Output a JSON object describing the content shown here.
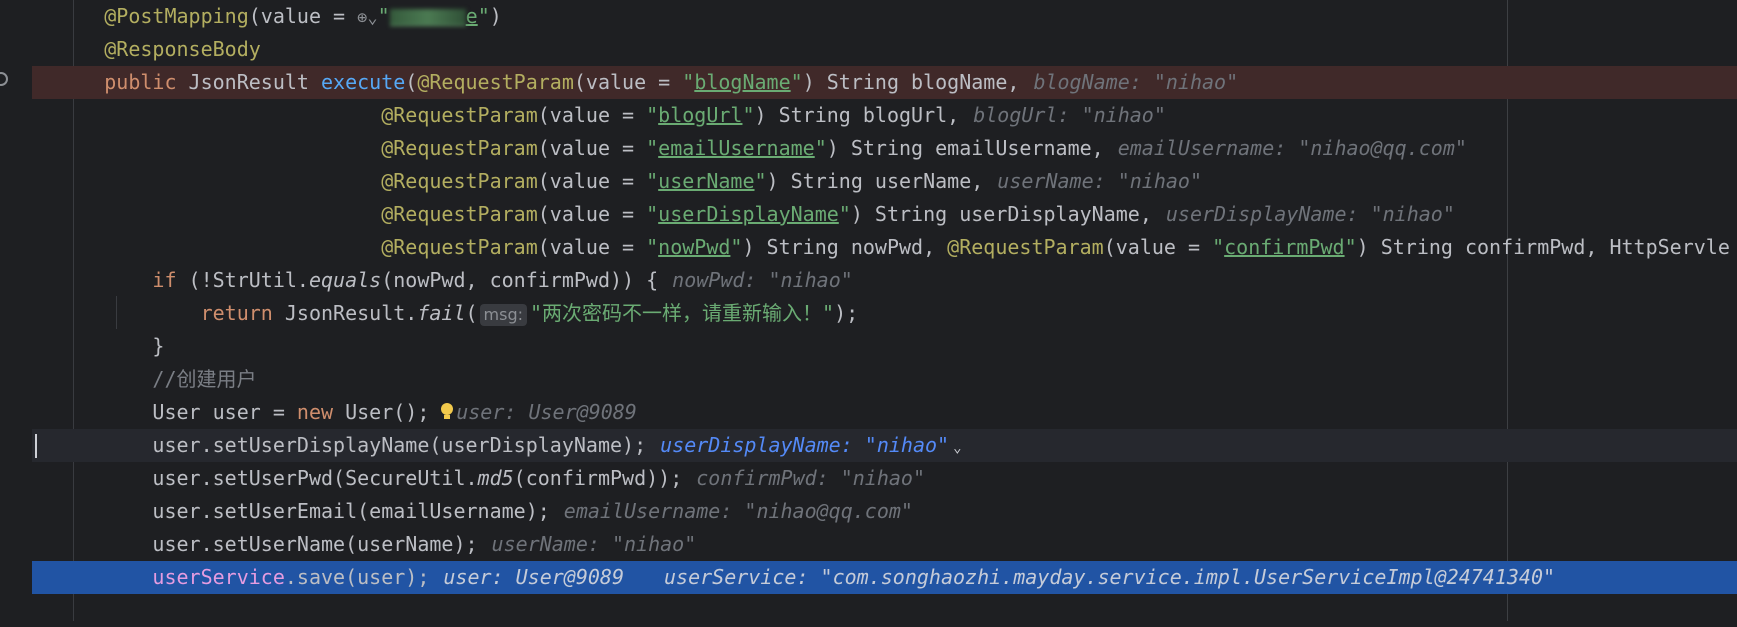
{
  "lines": [
    {
      "indent": "    ",
      "segments": [
        {
          "t": "@PostMapping",
          "c": "ann"
        },
        {
          "t": "(value = "
        },
        {
          "icon": "globe"
        },
        {
          "t": "\"",
          "c": "str"
        },
        {
          "blur": true
        },
        {
          "t": "e",
          "c": "str ul"
        },
        {
          "t": "\"",
          "c": "str"
        },
        {
          "t": ")"
        }
      ]
    },
    {
      "indent": "    ",
      "segments": [
        {
          "t": "@ResponseBody",
          "c": "ann"
        }
      ]
    },
    {
      "indent": "    ",
      "cls": "bp",
      "segments": [
        {
          "t": "public",
          "c": "kw"
        },
        {
          "t": " JsonResult "
        },
        {
          "t": "execute",
          "c": "fn"
        },
        {
          "t": "("
        },
        {
          "t": "@RequestParam",
          "c": "ann"
        },
        {
          "t": "(value = "
        },
        {
          "t": "\"",
          "c": "str"
        },
        {
          "t": "blogName",
          "c": "str ul"
        },
        {
          "t": "\"",
          "c": "str"
        },
        {
          "t": ") String blogName,"
        },
        {
          "hint": "blogName: \"nihao\""
        }
      ]
    },
    {
      "indent": "                           ",
      "segments": [
        {
          "t": "@RequestParam",
          "c": "ann"
        },
        {
          "t": "(value = "
        },
        {
          "t": "\"",
          "c": "str"
        },
        {
          "t": "blogUrl",
          "c": "str ul"
        },
        {
          "t": "\"",
          "c": "str"
        },
        {
          "t": ") String blogUrl,"
        },
        {
          "hint": "blogUrl: \"nihao\""
        }
      ]
    },
    {
      "indent": "                           ",
      "segments": [
        {
          "t": "@RequestParam",
          "c": "ann"
        },
        {
          "t": "(value = "
        },
        {
          "t": "\"",
          "c": "str"
        },
        {
          "t": "emailUsername",
          "c": "str ul"
        },
        {
          "t": "\"",
          "c": "str"
        },
        {
          "t": ") String emailUsername,"
        },
        {
          "hint": "emailUsername: \"nihao@qq.com\""
        }
      ]
    },
    {
      "indent": "                           ",
      "segments": [
        {
          "t": "@RequestParam",
          "c": "ann"
        },
        {
          "t": "(value = "
        },
        {
          "t": "\"",
          "c": "str"
        },
        {
          "t": "userName",
          "c": "str ul"
        },
        {
          "t": "\"",
          "c": "str"
        },
        {
          "t": ") String userName,"
        },
        {
          "hint": "userName: \"nihao\""
        }
      ]
    },
    {
      "indent": "                           ",
      "segments": [
        {
          "t": "@RequestParam",
          "c": "ann"
        },
        {
          "t": "(value = "
        },
        {
          "t": "\"",
          "c": "str"
        },
        {
          "t": "userDisplayName",
          "c": "str ul"
        },
        {
          "t": "\"",
          "c": "str"
        },
        {
          "t": ") String userDisplayName,"
        },
        {
          "hint": "userDisplayName: \"nihao\""
        }
      ]
    },
    {
      "indent": "                           ",
      "segments": [
        {
          "t": "@RequestParam",
          "c": "ann"
        },
        {
          "t": "(value = "
        },
        {
          "t": "\"",
          "c": "str"
        },
        {
          "t": "nowPwd",
          "c": "str ul"
        },
        {
          "t": "\"",
          "c": "str"
        },
        {
          "t": ") String nowPwd, "
        },
        {
          "t": "@RequestParam",
          "c": "ann"
        },
        {
          "t": "(value = "
        },
        {
          "t": "\"",
          "c": "str"
        },
        {
          "t": "confirmPwd",
          "c": "str ul"
        },
        {
          "t": "\"",
          "c": "str"
        },
        {
          "t": ") String confirmPwd, HttpServle"
        }
      ]
    },
    {
      "indent": "        ",
      "segments": [
        {
          "t": "if",
          "c": "kw"
        },
        {
          "t": " (!StrUtil."
        },
        {
          "t": "equals",
          "c": "it"
        },
        {
          "t": "(nowPwd, confirmPwd)) {"
        },
        {
          "hint": "nowPwd: \"nihao\""
        }
      ]
    },
    {
      "indent": "            ",
      "segments": [
        {
          "t": "return",
          "c": "kw"
        },
        {
          "t": " JsonResult."
        },
        {
          "t": "fail",
          "c": "it"
        },
        {
          "t": "("
        },
        {
          "param": "msg:"
        },
        {
          "t": "\"两次密码不一样，请重新输入！\"",
          "c": "str"
        },
        {
          "t": ");"
        }
      ]
    },
    {
      "indent": "        ",
      "segments": [
        {
          "t": "}"
        }
      ]
    },
    {
      "indent": "        ",
      "segments": [
        {
          "t": "//创建用户",
          "c": "comment"
        }
      ]
    },
    {
      "indent": "        ",
      "segments": [
        {
          "t": "User user = "
        },
        {
          "t": "new",
          "c": "kw"
        },
        {
          "t": " User();"
        },
        {
          "bulb": true
        },
        {
          "hint": "user: User@9089",
          "tight": true
        }
      ]
    },
    {
      "indent": "        ",
      "cls": "current",
      "caret": true,
      "segments": [
        {
          "t": "user.setUserDisplayName(userDisplayName);"
        },
        {
          "hint": "userDisplayName: \"nihao\"",
          "active": true
        },
        {
          "chev": true
        }
      ]
    },
    {
      "indent": "        ",
      "segments": [
        {
          "t": "user.setUserPwd(SecureUtil."
        },
        {
          "t": "md5",
          "c": "it"
        },
        {
          "t": "(confirmPwd));"
        },
        {
          "hint": "confirmPwd: \"nihao\""
        }
      ]
    },
    {
      "indent": "        ",
      "segments": [
        {
          "t": "user.setUserEmail(emailUsername);"
        },
        {
          "hint": "emailUsername: \"nihao@qq.com\""
        }
      ]
    },
    {
      "indent": "        ",
      "segments": [
        {
          "t": "user.setUserName(userName);"
        },
        {
          "hint": "userName: \"nihao\""
        }
      ]
    },
    {
      "indent": "        ",
      "cls": "exec",
      "segments": [
        {
          "t": "userService",
          "c": "field"
        },
        {
          "t": ".save(user);"
        },
        {
          "hint": "user: User@9089"
        },
        {
          "hint": "userService: \"com.songhaozhi.mayday.service.impl.UserServiceImpl@24741340\"",
          "wide": true
        }
      ]
    },
    {
      "indent": "",
      "segments": []
    }
  ],
  "icons": {
    "globe": "globe-icon",
    "bulb": "lightbulb-icon",
    "chevron": "chevron-down-icon",
    "breakpoint": "breakpoint-icon"
  }
}
